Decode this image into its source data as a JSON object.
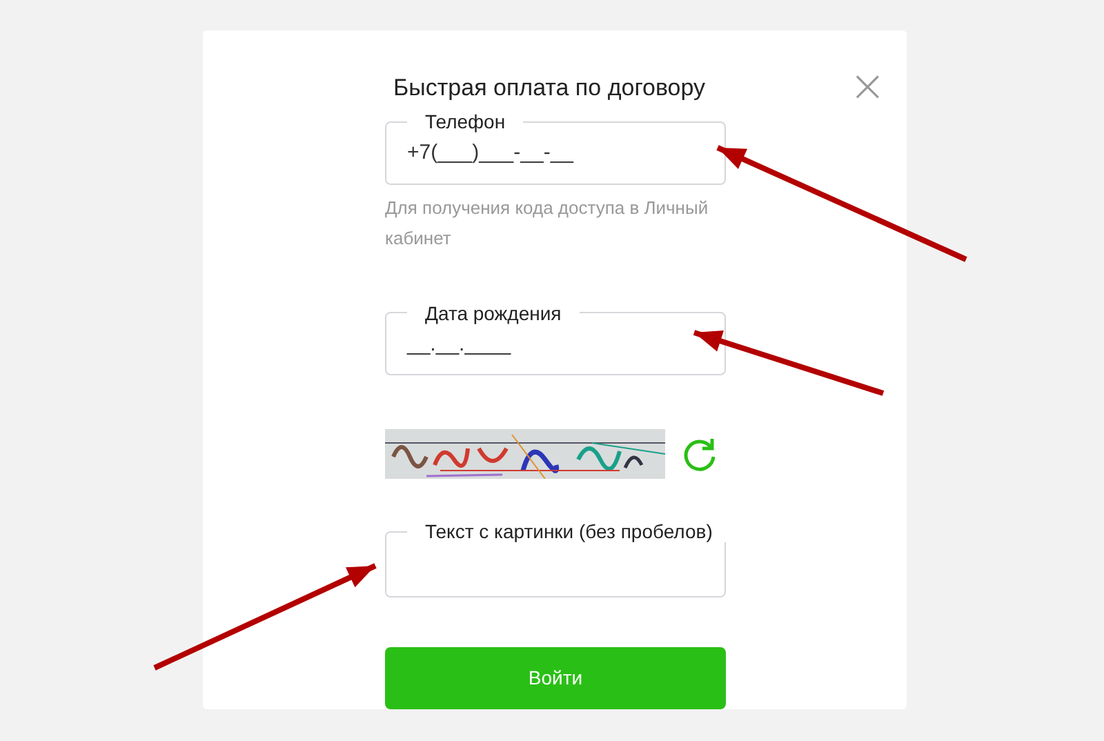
{
  "dialog": {
    "title": "Быстрая оплата по договору",
    "close": "×"
  },
  "fields": [
    {
      "kind": "masked",
      "label": "Телефон",
      "value": "+7(___)___-__-__",
      "hint": "Для получения кода доступа в Личный кабинет"
    },
    {
      "kind": "masked",
      "label": "Дата рождения",
      "value": "__.__.____"
    },
    {
      "kind": "captcha"
    },
    {
      "kind": "text",
      "label": "Текст с картинки (без пробелов)"
    }
  ],
  "submit": "Войти",
  "annotations": [
    {
      "kind": "arrow"
    },
    {
      "kind": "arrow"
    },
    {
      "kind": "arrow"
    }
  ]
}
